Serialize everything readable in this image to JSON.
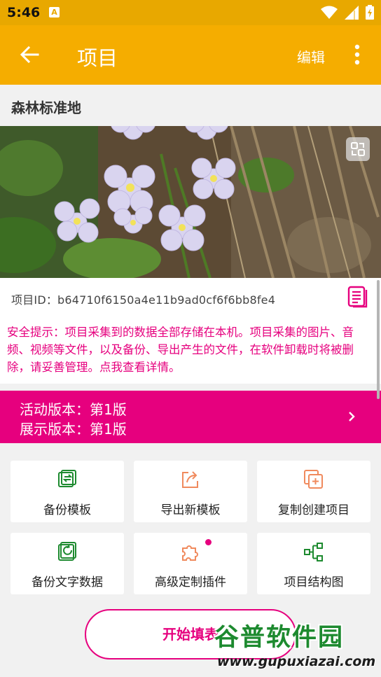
{
  "status_bar": {
    "time": "5:46",
    "notification_icon": "A"
  },
  "app_bar": {
    "title": "项目",
    "edit_label": "编辑"
  },
  "project": {
    "name": "森林标准地",
    "id_text": "项目ID：b64710f6150a4e11b9ad0cf6f6bb8fe4"
  },
  "notice": {
    "text": "安全提示：项目采集到的数据全部存储在本机。项目采集的图片、音频、视频等文件，以及备份、导出产生的文件，在软件卸载时将被删除，请妥善管理。点我查看详情。"
  },
  "version": {
    "active": "活动版本：第1版",
    "display": "展示版本：第1版"
  },
  "actions": [
    {
      "label": "备份模板",
      "icon": "backup-template-icon"
    },
    {
      "label": "导出新模板",
      "icon": "export-share-icon"
    },
    {
      "label": "复制创建项目",
      "icon": "copy-create-icon"
    },
    {
      "label": "备份文字数据",
      "icon": "backup-text-icon"
    },
    {
      "label": "高级定制插件",
      "icon": "puzzle-plugin-icon"
    },
    {
      "label": "项目结构图",
      "icon": "structure-diagram-icon"
    }
  ],
  "start_button": {
    "label": "开始填表"
  },
  "watermark": {
    "cn": "谷普软件园",
    "en": "www.gupuxiazai.com"
  },
  "colors": {
    "accent": "#f5ad00",
    "status": "#e8a800",
    "magenta": "#e6007e",
    "green": "#1d8a2f",
    "orange": "#f08a5d"
  }
}
